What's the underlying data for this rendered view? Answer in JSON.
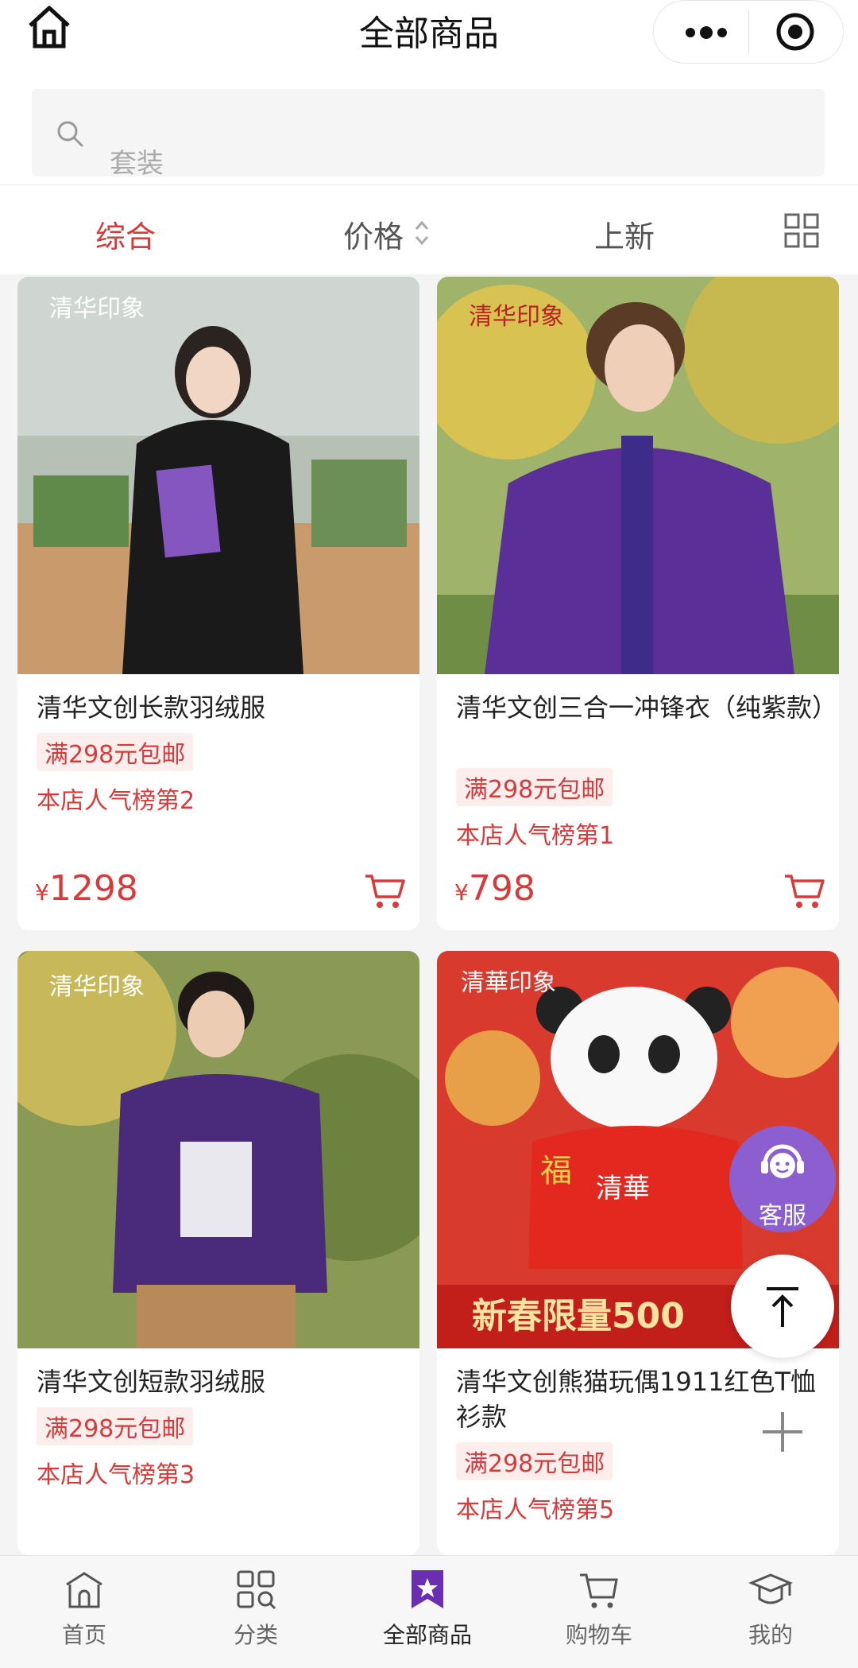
{
  "header": {
    "title": "全部商品"
  },
  "search": {
    "placeholder": "套装"
  },
  "filter": {
    "tabs": [
      "综合",
      "价格",
      "上新"
    ]
  },
  "products": [
    {
      "name": "清华文创长款羽绒服",
      "badge": "满298元包邮",
      "rank": "本店人气榜第2",
      "currency": "¥",
      "price": "1298"
    },
    {
      "name": "清华文创三合一冲锋衣（纯紫款）",
      "badge": "满298元包邮",
      "rank": "本店人气榜第1",
      "currency": "¥",
      "price": "798"
    },
    {
      "name": "清华文创短款羽绒服",
      "badge": "满298元包邮",
      "rank": "本店人气榜第3"
    },
    {
      "name": "清华文创熊猫玩偶1911红色T恤衫款",
      "badge": "满298元包邮",
      "rank": "本店人气榜第5"
    }
  ],
  "floating": {
    "customer_service": "客服"
  },
  "bottom_nav": [
    {
      "label": "首页",
      "icon": "home-building-icon"
    },
    {
      "label": "分类",
      "icon": "category-grid-icon"
    },
    {
      "label": "全部商品",
      "icon": "star-bookmark-icon"
    },
    {
      "label": "购物车",
      "icon": "cart-icon"
    },
    {
      "label": "我的",
      "icon": "graduation-cap-icon"
    }
  ],
  "colors": {
    "accent": "#d83a3a",
    "purple": "#8b5fcf",
    "nav_active": "#6a2fb0"
  }
}
